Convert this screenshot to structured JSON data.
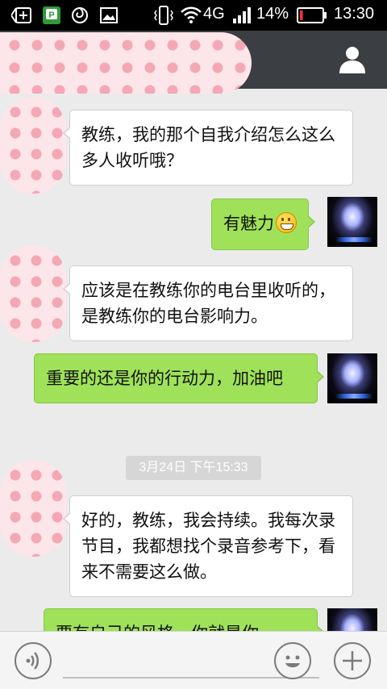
{
  "status_bar": {
    "network": "4G",
    "battery_percent": "14%",
    "time": "13:30",
    "battery_level": 0.14,
    "battery_color": "#ff2d2d"
  },
  "header": {
    "title_redacted": true,
    "profile_icon": "person-icon"
  },
  "messages": [
    {
      "side": "in",
      "text": "教练，我的那个自我介绍怎么这么多人收听哦？"
    },
    {
      "side": "out",
      "text": "有魅力",
      "emoji": "grin-emoji"
    },
    {
      "side": "in",
      "text": "应该是在教练你的电台里收听的，是教练你的电台影响力。"
    },
    {
      "side": "out",
      "text": "重要的还是你的行动力，加油吧"
    },
    {
      "side": "in",
      "text": "好的，教练，我会持续。我每次录节目，我都想找个录音参考下，看来不需要这么做。"
    },
    {
      "side": "out",
      "text": "要有自己的风格，你就是你"
    }
  ],
  "timestamp": "3月24日 下午15:33",
  "toolbar": {
    "voice_icon": "voice-icon",
    "emoji_icon": "smiley-icon",
    "add_icon": "plus-icon",
    "input_value": ""
  },
  "colors": {
    "header_bg": "#3b3f43",
    "chat_bg": "#ebebeb",
    "incoming_bubble": "#ffffff",
    "outgoing_bubble": "#9fe25a"
  }
}
